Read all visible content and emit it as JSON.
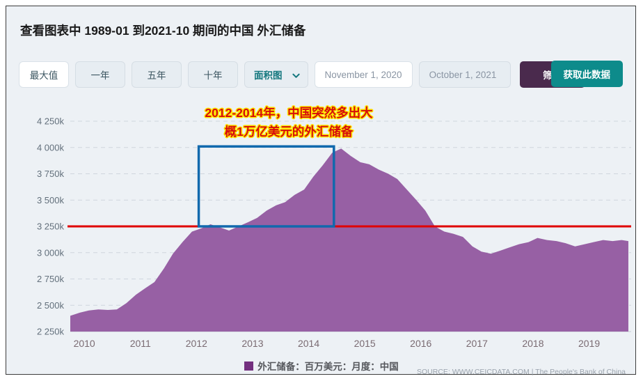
{
  "header": {
    "title_prefix": "查看图表中",
    "range_start": "1989-01",
    "title_mid": "到",
    "range_end": "2021-10",
    "title_suffix": "期间的中国 外汇储备",
    "title_full": "查看图表中 1989-01 到2021-10 期间的中国 外汇储备"
  },
  "toolbar": {
    "range_buttons": [
      {
        "label": "最大值",
        "active": true
      },
      {
        "label": "一年",
        "active": false
      },
      {
        "label": "五年",
        "active": false
      },
      {
        "label": "十年",
        "active": false
      }
    ],
    "chart_type_select": {
      "value": "面积图",
      "icon": "chevron-down-icon"
    },
    "date_from": "November 1, 2020",
    "date_to": "October 1, 2021",
    "filter_label": "筛选",
    "get_data_label": "获取此数据",
    "filter_color": "#4a2a4d",
    "get_data_color": "#0d8b8b",
    "accent_teal": "#14777e"
  },
  "annotation": {
    "line1": "2012-2014年，中国突然多出大",
    "line2": "概1万亿美元的外汇储备",
    "text_color": "#d60d0d",
    "outline_color": "#ffe800",
    "box_color": "#1169ad",
    "reference_line_color": "#e00000",
    "reference_line_value": 3250000
  },
  "legend": {
    "swatch_color": "#73307f",
    "label": "外汇储备：百万美元：月度：中国"
  },
  "source": "SOURCE: WWW.CEICDATA.COM | The People's Bank of China",
  "chart_data": {
    "type": "area",
    "title": "",
    "xlabel": "",
    "ylabel": "",
    "series_name": "外汇储备：百万美元：月度：中国",
    "fill_color": "#9760a4",
    "ylim": [
      2250000,
      4250000
    ],
    "ytick_labels": [
      "4 250k",
      "4 000k",
      "3 750k",
      "3 500k",
      "3 250k",
      "3 000k",
      "2 750k",
      "2 500k",
      "2 250k"
    ],
    "ytick_values": [
      4250000,
      4000000,
      3750000,
      3500000,
      3250000,
      3000000,
      2750000,
      2500000,
      2250000
    ],
    "xtick_labels": [
      "2010",
      "2011",
      "2012",
      "2013",
      "2014",
      "2015",
      "2016",
      "2017",
      "2018",
      "2019"
    ],
    "xtick_values": [
      2010,
      2011,
      2012,
      2013,
      2014,
      2015,
      2016,
      2017,
      2018,
      2019
    ],
    "xlim": [
      2009.75,
      2019.75
    ],
    "grid": true,
    "x": [
      2009.75,
      2009.92,
      2010.08,
      2010.25,
      2010.42,
      2010.58,
      2010.75,
      2010.92,
      2011.08,
      2011.25,
      2011.42,
      2011.58,
      2011.75,
      2011.92,
      2012.08,
      2012.25,
      2012.42,
      2012.58,
      2012.75,
      2012.92,
      2013.08,
      2013.25,
      2013.42,
      2013.58,
      2013.75,
      2013.92,
      2014.08,
      2014.25,
      2014.42,
      2014.58,
      2014.75,
      2014.92,
      2015.08,
      2015.25,
      2015.42,
      2015.58,
      2015.75,
      2015.92,
      2016.08,
      2016.25,
      2016.42,
      2016.58,
      2016.75,
      2016.92,
      2017.08,
      2017.25,
      2017.42,
      2017.58,
      2017.75,
      2017.92,
      2018.08,
      2018.25,
      2018.42,
      2018.58,
      2018.75,
      2018.92,
      2019.08,
      2019.25,
      2019.42,
      2019.58,
      2019.7
    ],
    "values": [
      2400000,
      2430000,
      2450000,
      2460000,
      2455000,
      2460000,
      2520000,
      2600000,
      2660000,
      2720000,
      2850000,
      2990000,
      3100000,
      3200000,
      3230000,
      3270000,
      3240000,
      3210000,
      3250000,
      3290000,
      3330000,
      3400000,
      3450000,
      3480000,
      3550000,
      3600000,
      3720000,
      3830000,
      3950000,
      3990000,
      3920000,
      3860000,
      3840000,
      3790000,
      3750000,
      3700000,
      3600000,
      3500000,
      3400000,
      3250000,
      3200000,
      3180000,
      3150000,
      3060000,
      3010000,
      2990000,
      3020000,
      3050000,
      3080000,
      3100000,
      3140000,
      3120000,
      3110000,
      3090000,
      3060000,
      3080000,
      3100000,
      3120000,
      3110000,
      3120000,
      3110000
    ]
  }
}
